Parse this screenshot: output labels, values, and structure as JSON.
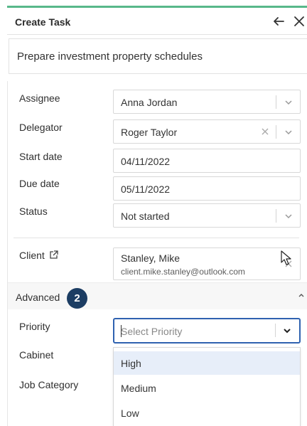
{
  "header": {
    "title": "Create Task"
  },
  "task": {
    "name": "Prepare investment property schedules"
  },
  "form": {
    "assignee": {
      "label": "Assignee",
      "value": "Anna Jordan"
    },
    "delegator": {
      "label": "Delegator",
      "value": "Roger Taylor"
    },
    "start_date": {
      "label": "Start date",
      "value": "04/11/2022"
    },
    "due_date": {
      "label": "Due date",
      "value": "05/11/2022"
    },
    "status": {
      "label": "Status",
      "value": "Not started"
    },
    "client": {
      "label": "Client",
      "name": "Stanley, Mike",
      "email": "client.mike.stanley@outlook.com"
    }
  },
  "advanced": {
    "label": "Advanced",
    "step_badge": "2",
    "priority": {
      "label": "Priority",
      "placeholder": "Select Priority"
    },
    "cabinet": {
      "label": "Cabinet"
    },
    "job_category": {
      "label": "Job Category"
    },
    "priority_options": [
      "High",
      "Medium",
      "Low"
    ]
  },
  "colors": {
    "accent": "#58b88a",
    "focus": "#2f62b0",
    "badge": "#1c3d63",
    "highlight": "#e7eef9"
  }
}
